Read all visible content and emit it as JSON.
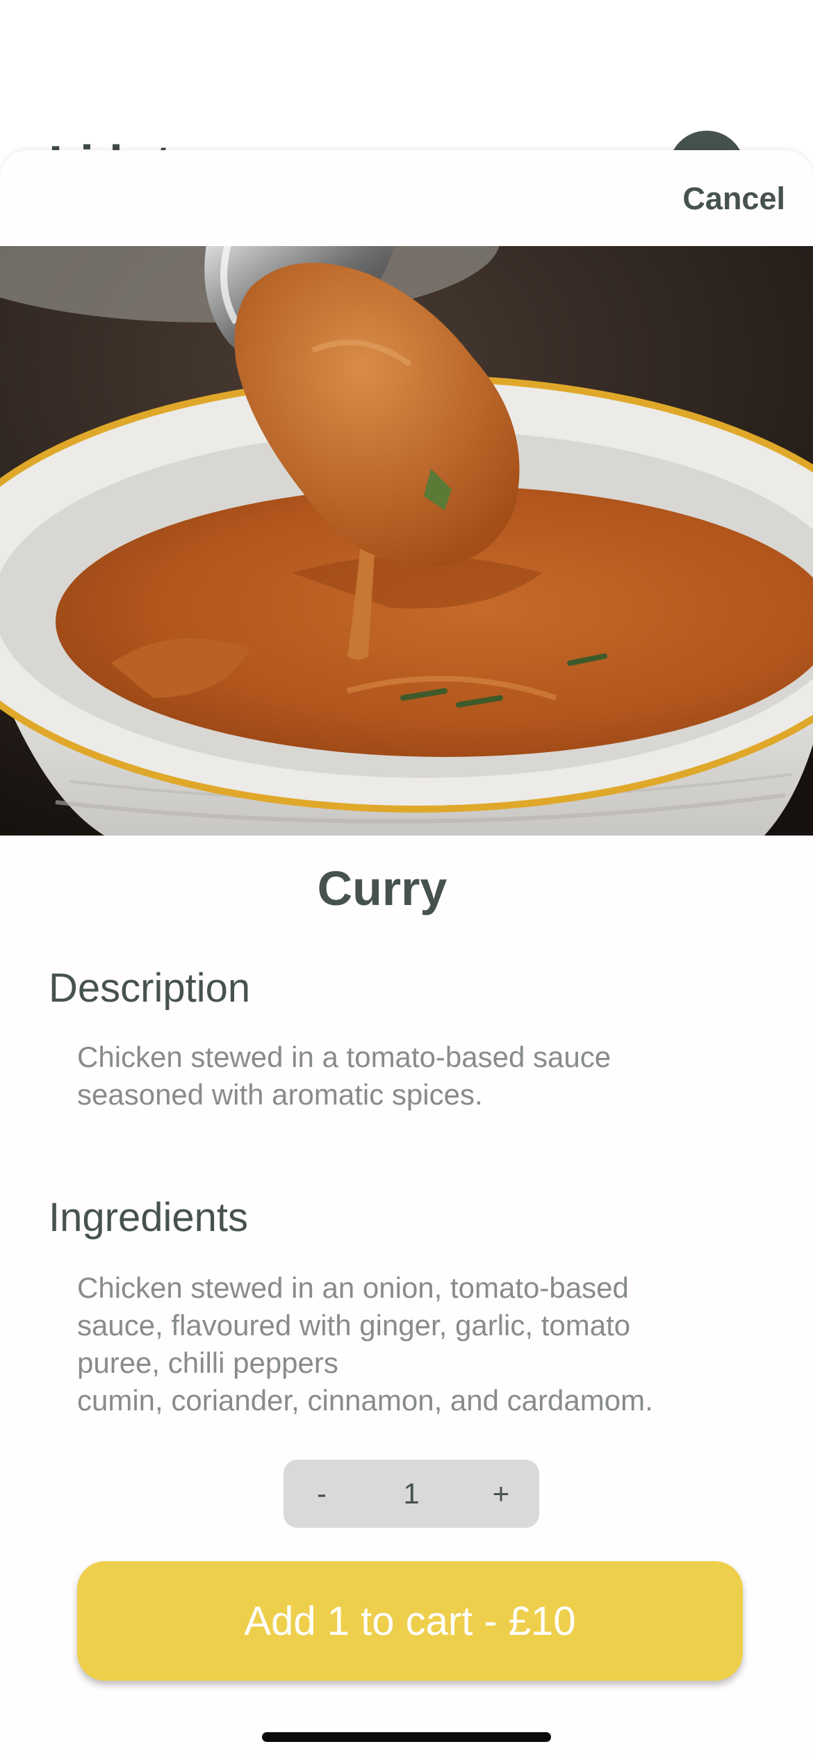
{
  "background": {
    "title_partial": "Li  h  t"
  },
  "sheet": {
    "cancel_label": "Cancel",
    "item": {
      "title": "Curry",
      "description_heading": "Description",
      "description_text": "Chicken stewed in a tomato-based sauce\nseasoned with aromatic spices.",
      "ingredients_heading": "Ingredients",
      "ingredients_text": "Chicken stewed in an onion, tomato-based\nsauce, flavoured with ginger, garlic, tomato\npuree, chilli peppers\ncumin, coriander, cinnamon, and cardamom."
    },
    "stepper": {
      "decrement_label": "-",
      "quantity": "1",
      "increment_label": "+"
    },
    "add_to_cart_label": "Add 1 to cart - £10"
  },
  "colors": {
    "accent_yellow": "#eecf4c",
    "text_dark_green": "#46524d",
    "text_muted": "#878c8a",
    "stepper_bg": "#d9d9d9"
  },
  "icons": {
    "hero_image": "curry-photo"
  }
}
